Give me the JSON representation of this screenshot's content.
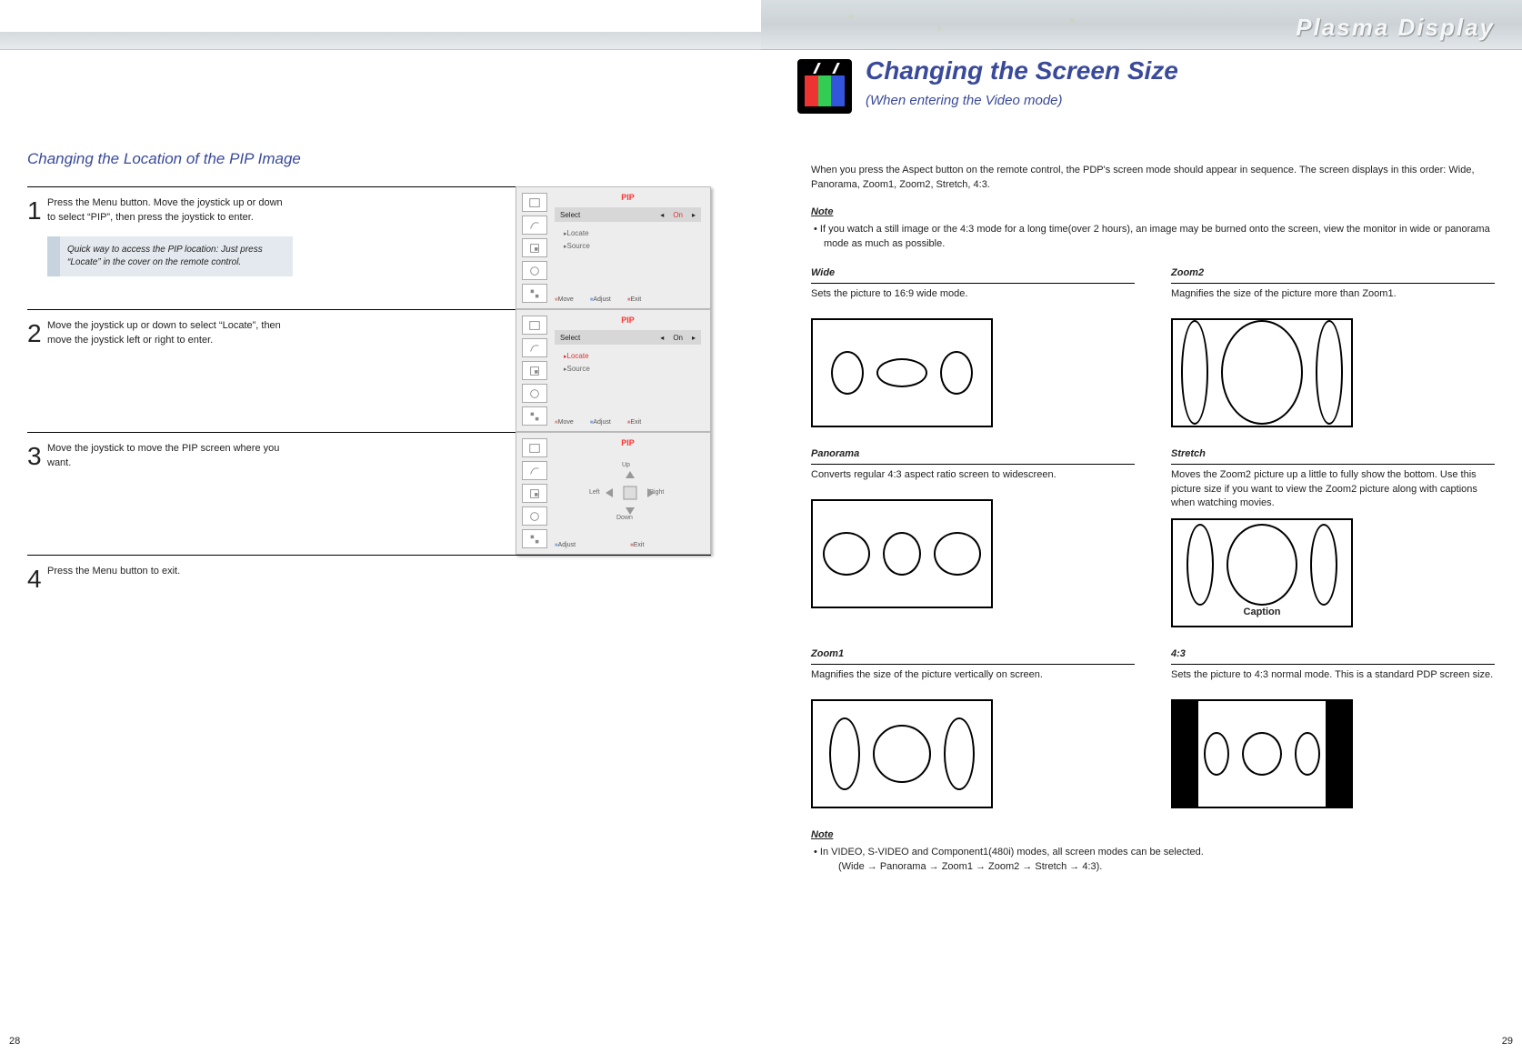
{
  "banner": {
    "product": "Plasma Display"
  },
  "right_page": {
    "title": "Changing the Screen Size",
    "subtitle": "(When entering the Video mode)",
    "intro": "When you press the Aspect button on the remote control, the PDP's screen mode should appear in sequence. The screen displays in this order: Wide, Panorama, Zoom1, Zoom2, Stretch, 4:3.",
    "note1_head": "Note",
    "note1_body": "If you watch a still image or the 4:3 mode for a long time(over 2 hours), an image may be burned onto the screen, view the monitor in wide or panorama mode as much as possible.",
    "modes": {
      "wide": {
        "name": "Wide",
        "desc": "Sets the picture to 16:9 wide mode."
      },
      "zoom2": {
        "name": "Zoom2",
        "desc": "Magnifies the size of the picture more than Zoom1."
      },
      "panorama": {
        "name": "Panorama",
        "desc": "Converts regular 4:3 aspect ratio screen to widescreen."
      },
      "stretch": {
        "name": "Stretch",
        "desc": "Moves the Zoom2 picture up a little to fully show the bottom. Use this picture size if you want to view the Zoom2 picture along with captions when watching movies.",
        "caption": "Caption"
      },
      "zoom1": {
        "name": "Zoom1",
        "desc": "Magnifies the size of the picture vertically on screen."
      },
      "four_three": {
        "name": "4:3",
        "desc": "Sets the picture to 4:3 normal mode. This is a standard PDP screen size."
      }
    },
    "note2_head": "Note",
    "note2_line1": "In VIDEO, S-VIDEO and Component1(480i) modes, all screen modes can be selected.",
    "note2_line2": "(Wide → Panorama →  Zoom1 →  Zoom2 → Stretch → 4:3).",
    "page_num": "29"
  },
  "left_page": {
    "title": "Changing the Location of the PIP Image",
    "steps": [
      {
        "num": "1",
        "text": "Press the Menu button. Move the joystick up or down to select “PIP”, then press the joystick to enter.",
        "tip": "Quick way to access the PIP location: Just press “Locate” in the cover on the remote control.",
        "osd": {
          "header": "PIP",
          "select_label": "Select",
          "select_value": "On",
          "opt1": "Locate",
          "opt2": "Source",
          "active": "none",
          "foot": [
            "Move",
            "Adjust",
            "Exit"
          ]
        }
      },
      {
        "num": "2",
        "text": "Move the joystick up or down to select “Locate”, then move the joystick left or right to enter.",
        "osd": {
          "header": "PIP",
          "select_label": "Select",
          "select_value": "On",
          "opt1": "Locate",
          "opt2": "Source",
          "active": "opt1",
          "foot": [
            "Move",
            "Adjust",
            "Exit"
          ]
        }
      },
      {
        "num": "3",
        "text": "Move the joystick to move the PIP screen where you want.",
        "osd": {
          "header": "PIP",
          "arrows": {
            "up": "Up",
            "down": "Down",
            "left": "Left",
            "right": "Right"
          },
          "foot": [
            "Adjust",
            "Exit"
          ]
        }
      },
      {
        "num": "4",
        "text": "Press the Menu button to exit."
      }
    ],
    "page_num": "28"
  }
}
